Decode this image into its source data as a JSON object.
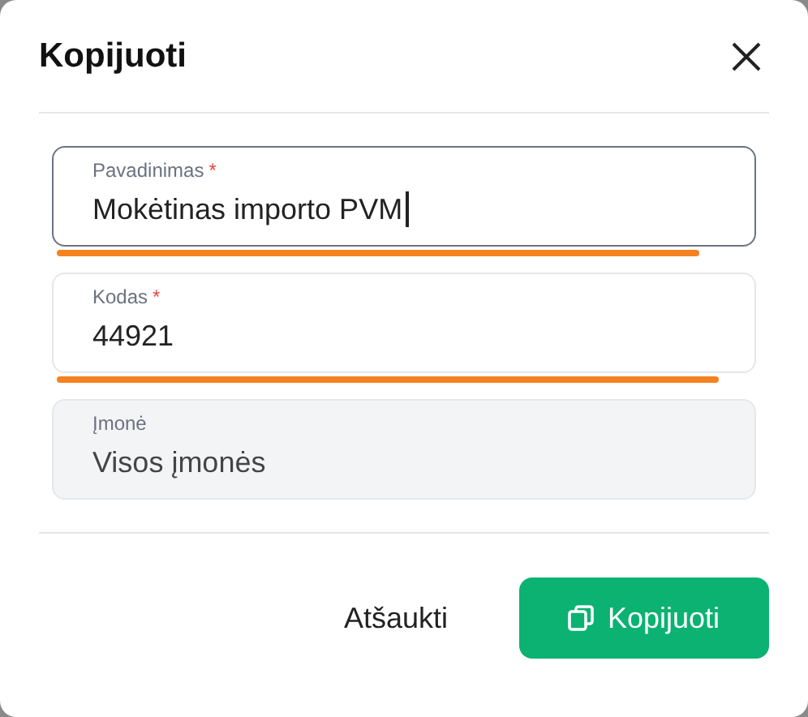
{
  "dialog": {
    "title": "Kopijuoti"
  },
  "fields": [
    {
      "label": "Pavadinimas",
      "required_mark": "*",
      "value": "Mokėtinas importo PVM",
      "focused": true,
      "disabled": false,
      "underlined": true
    },
    {
      "label": "Kodas",
      "required_mark": "*",
      "value": "44921",
      "focused": false,
      "disabled": false,
      "underlined": true
    },
    {
      "label": "Įmonė",
      "value": "Visos įmonės",
      "focused": false,
      "disabled": true,
      "underlined": false
    }
  ],
  "buttons": [
    {
      "kind": "text",
      "label": "Atšaukti"
    },
    {
      "kind": "primary",
      "label": "Kopijuoti"
    }
  ]
}
